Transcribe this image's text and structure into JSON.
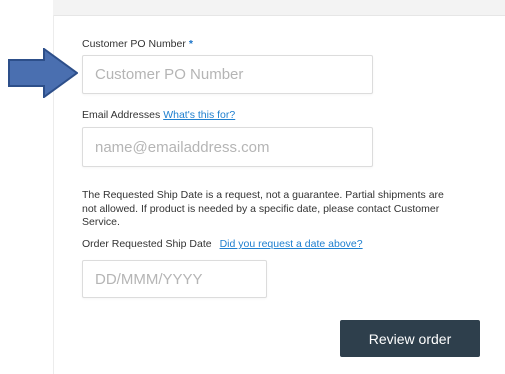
{
  "po_field": {
    "label": "Customer PO Number",
    "required_marker": "*",
    "placeholder": "Customer PO Number"
  },
  "email_field": {
    "label": "Email Addresses",
    "help_link": "What's this for?",
    "placeholder": "name@emailaddress.com"
  },
  "ship_notice": {
    "text": "The Requested Ship Date is a request, not a guarantee. Partial shipments are not allowed. If product is needed by a specific date, please contact Customer Service."
  },
  "ship_date_field": {
    "label": "Order Requested Ship Date",
    "help_link": "Did you request a date above?",
    "placeholder": "DD/MMM/YYYY"
  },
  "actions": {
    "review_label": "Review order"
  },
  "colors": {
    "arrow_fill": "#4a6fb0",
    "arrow_stroke": "#2d4f8a",
    "link": "#1e7fcf",
    "button_bg": "#2e3f4c"
  }
}
